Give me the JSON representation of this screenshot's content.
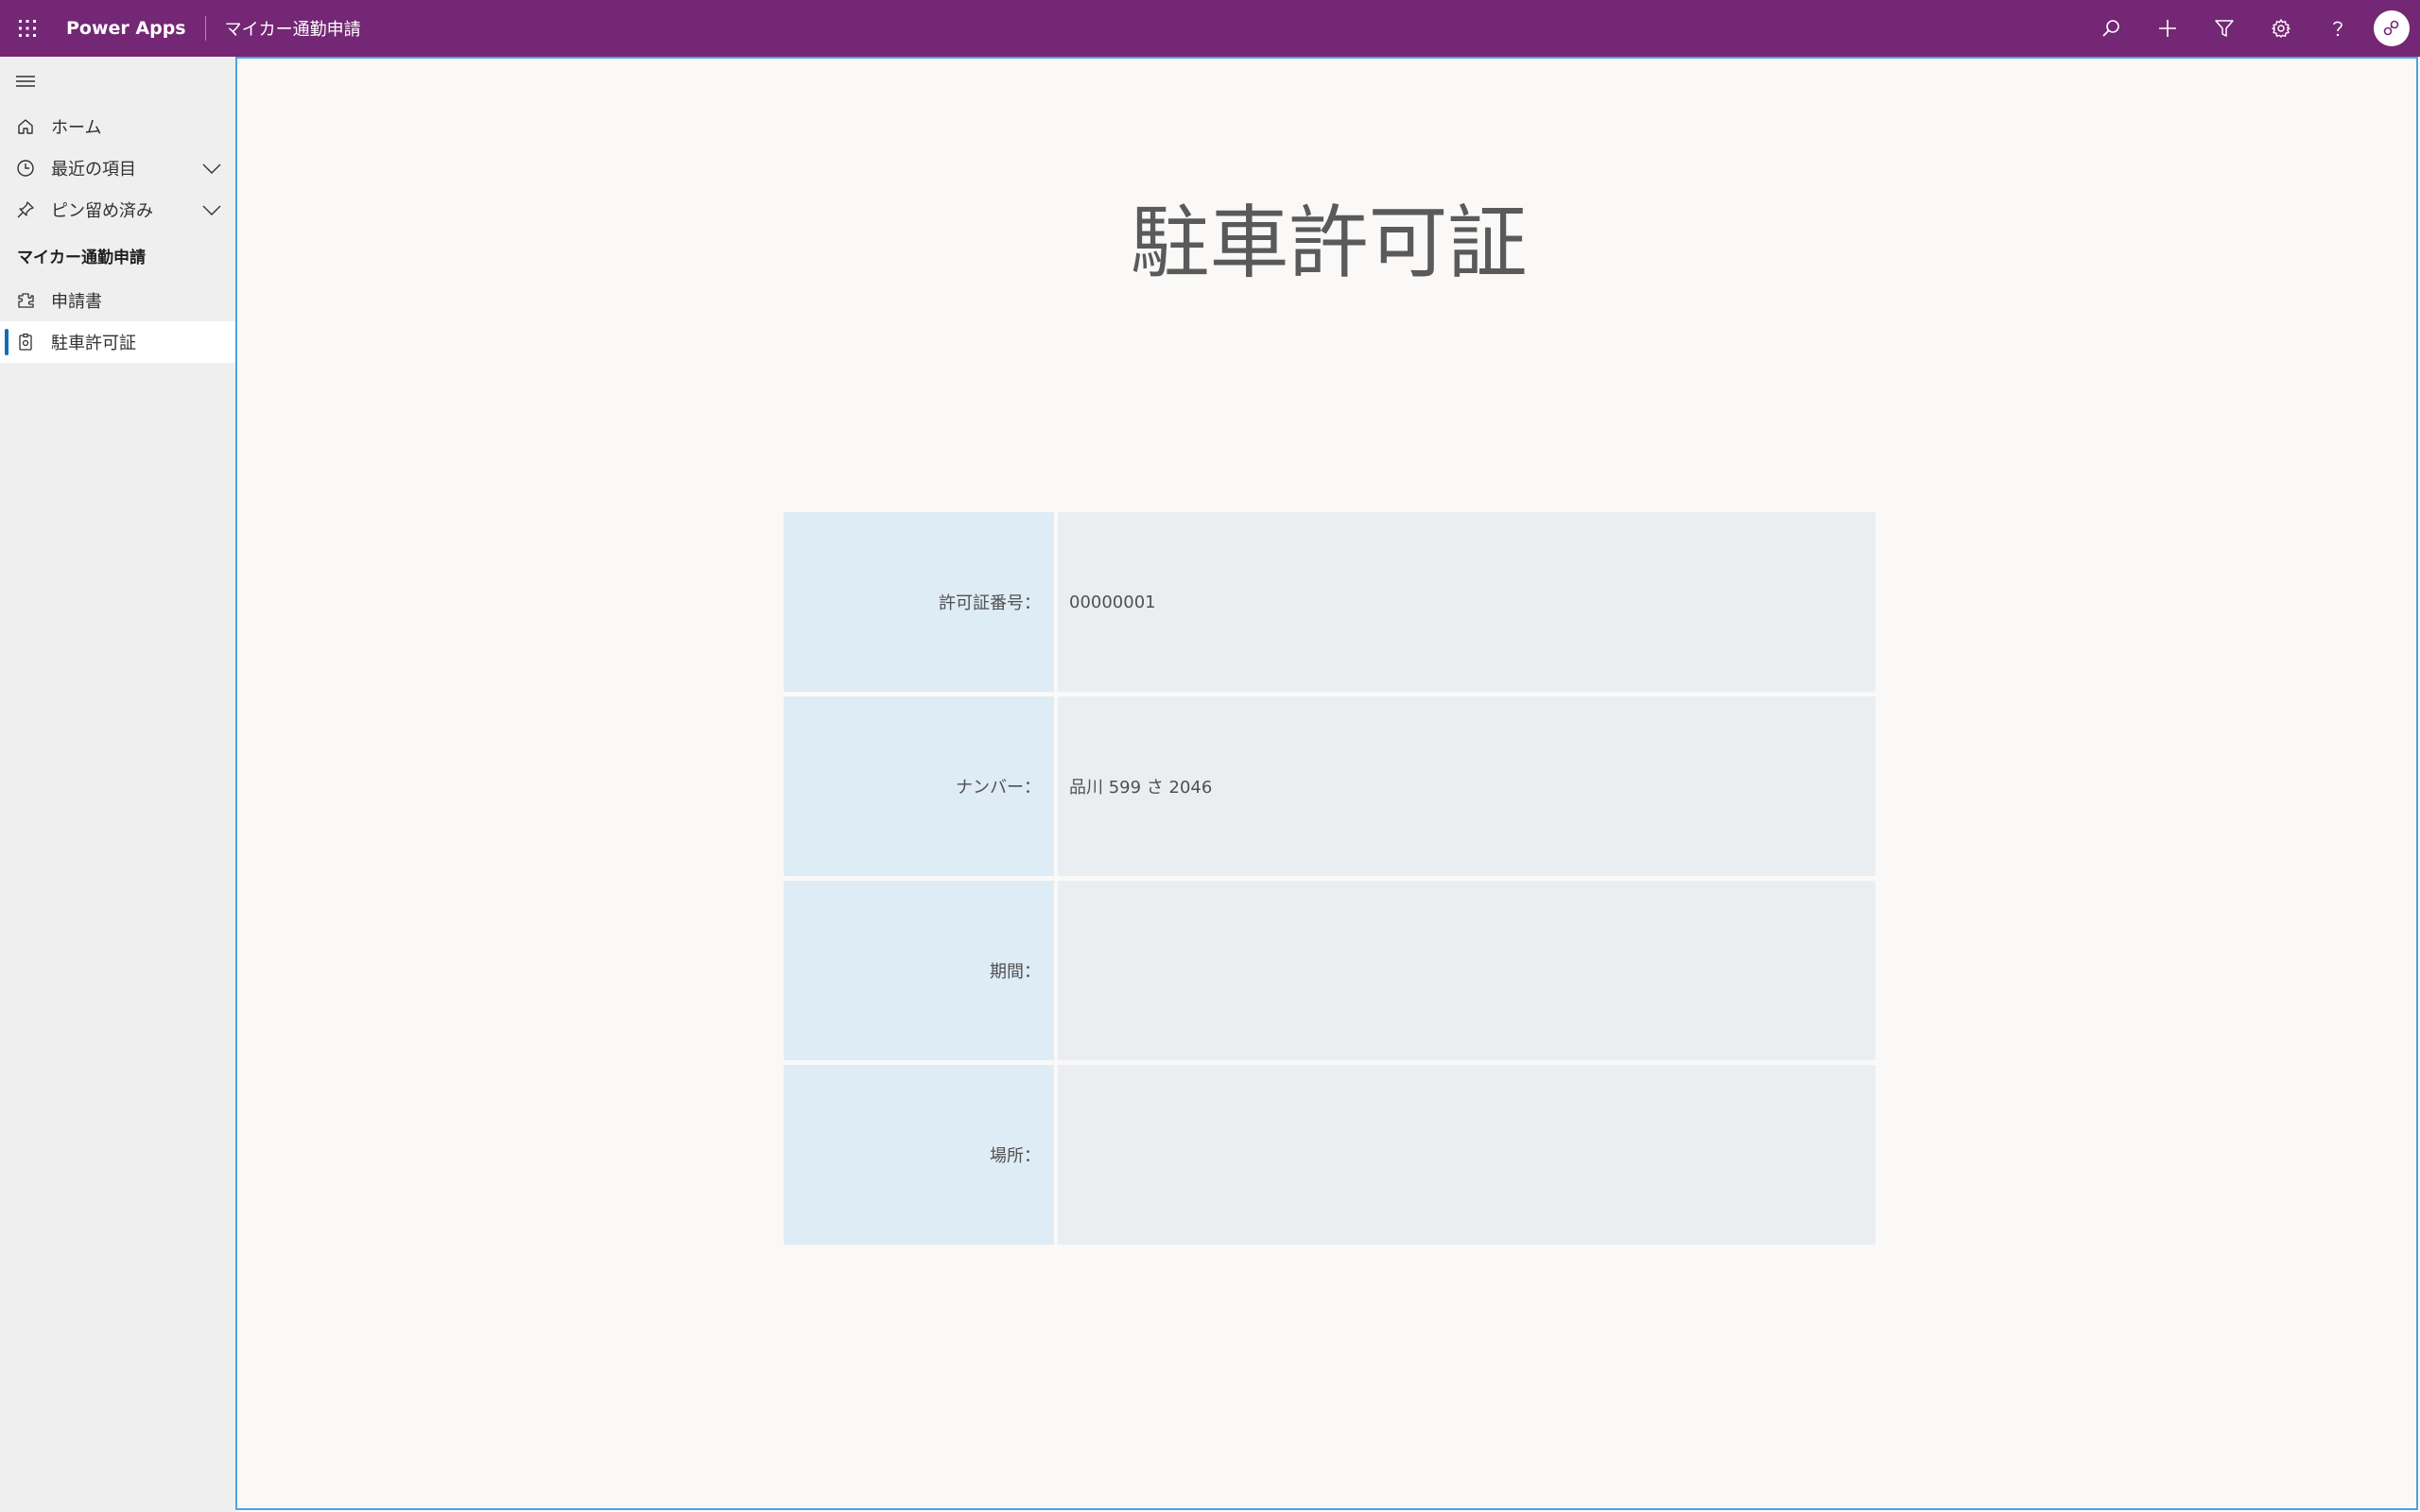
{
  "topbar": {
    "brand": "Power Apps",
    "app_name": "マイカー通勤申請",
    "actions": [
      {
        "icon": "search-icon"
      },
      {
        "icon": "plus-icon"
      },
      {
        "icon": "filter-icon"
      },
      {
        "icon": "gear-icon"
      },
      {
        "icon": "help-icon"
      }
    ],
    "color": "#742774"
  },
  "sidebar": {
    "items": [
      {
        "label": "ホーム",
        "icon": "home-icon"
      },
      {
        "label": "最近の項目",
        "icon": "clock-icon",
        "expandable": true
      },
      {
        "label": "ピン留め済み",
        "icon": "pin-icon",
        "expandable": true
      }
    ],
    "section_title": "マイカー通勤申請",
    "section_items": [
      {
        "label": "申請書",
        "icon": "puzzle-icon",
        "active": false
      },
      {
        "label": "駐車許可証",
        "icon": "badge-icon",
        "active": true
      }
    ]
  },
  "main": {
    "title": "駐車許可証",
    "rows": [
      {
        "label": "許可証番号：",
        "value": "00000001"
      },
      {
        "label": "ナンバー：",
        "value": "品川 599 さ 2046"
      },
      {
        "label": "期間：",
        "value": ""
      },
      {
        "label": "場所：",
        "value": ""
      }
    ]
  }
}
